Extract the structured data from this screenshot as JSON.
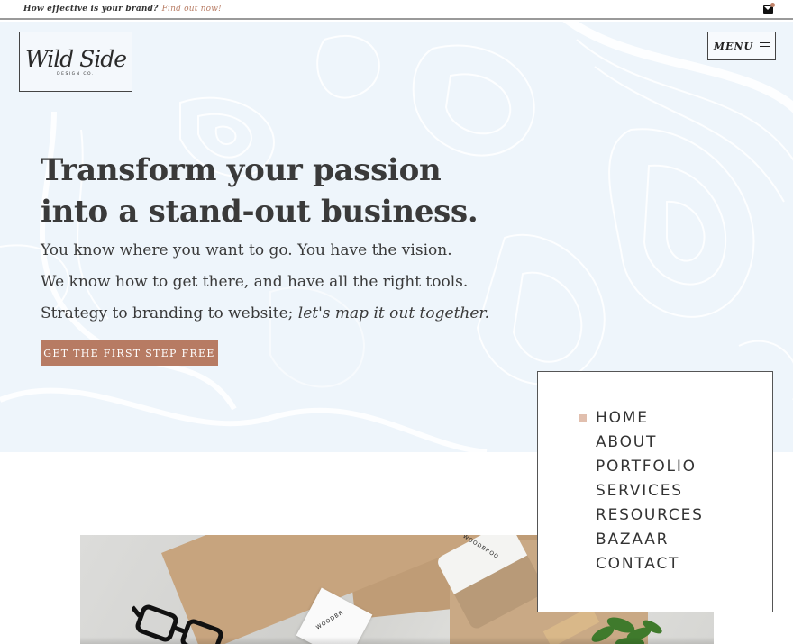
{
  "topbar": {
    "text": "How effective is your brand?",
    "link": "Find out now!"
  },
  "logo": {
    "script": "Wild Side",
    "sub": "DESIGN CO."
  },
  "menu": {
    "label": "MENU"
  },
  "hero": {
    "headline_line1": "Transform your passion",
    "headline_line2": "into a stand-out business.",
    "line1": "You know where you want to go. You have the vision.",
    "line2": "We know how to get there, and have all the right tools.",
    "line3_plain": "Strategy to branding to website;",
    "line3_italic": "let's map it out together.",
    "cta_label": "GET THE FIRST STEP FREE"
  },
  "nav": {
    "items": [
      {
        "label": "HOME",
        "active": true
      },
      {
        "label": "ABOUT",
        "active": false
      },
      {
        "label": "PORTFOLIO",
        "active": false
      },
      {
        "label": "SERVICES",
        "active": false
      },
      {
        "label": "RESOURCES",
        "active": false
      },
      {
        "label": "BAZAAR",
        "active": false
      },
      {
        "label": "CONTACT",
        "active": false
      }
    ]
  },
  "photo": {
    "card_text": "WOODBR",
    "tube_text": "WOODBROO"
  },
  "colors": {
    "accent": "#b77b63",
    "hero_bg": "#eef5fb",
    "active_marker": "#e1bfae"
  }
}
